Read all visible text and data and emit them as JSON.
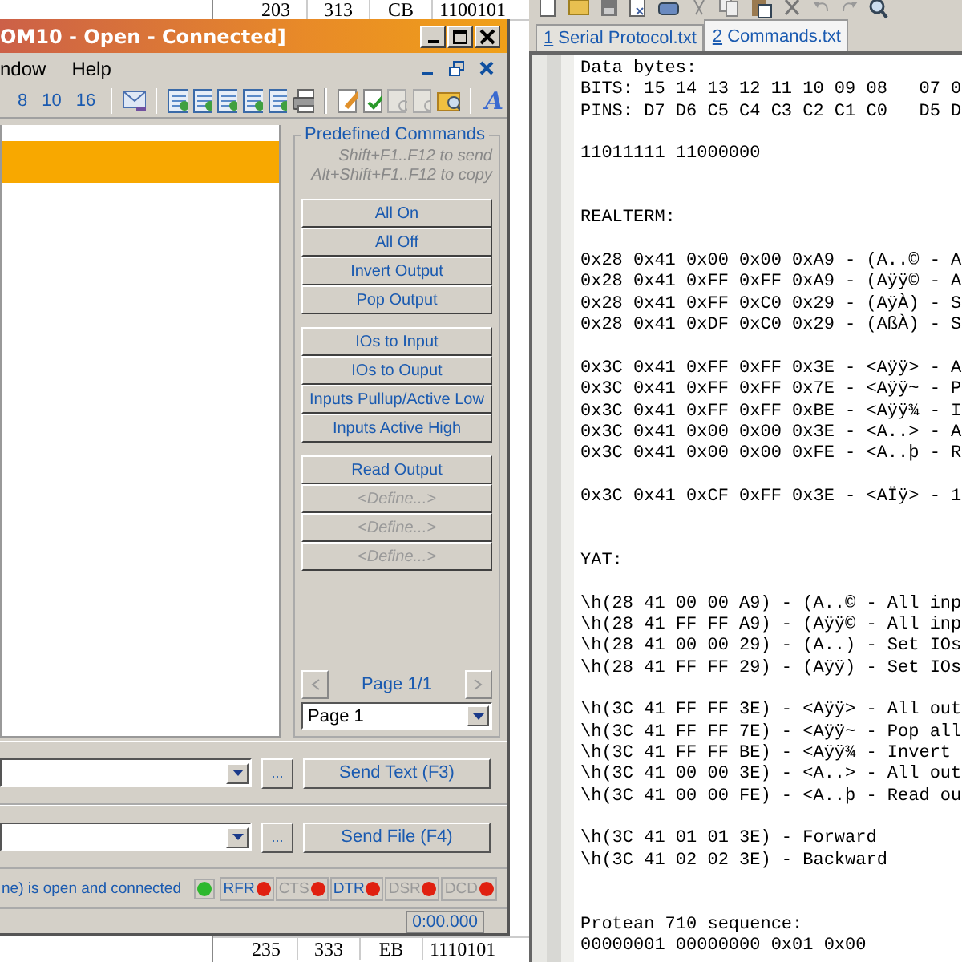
{
  "sheet": {
    "top_row": [
      "203",
      "313",
      "CB",
      "1100101"
    ],
    "bottom_row": [
      "235",
      "333",
      "EB",
      "1110101"
    ]
  },
  "terminal": {
    "title": "OM10 - Open - Connected]",
    "menu": [
      "ndow",
      "Help"
    ],
    "radix_buttons": [
      "8",
      "10",
      "16"
    ],
    "font_button": "A",
    "predefined": {
      "title": "Predefined Commands",
      "hint_send": "Shift+F1..F12 to send",
      "hint_copy": "Alt+Shift+F1..F12 to copy",
      "groups": [
        [
          {
            "label": "All On",
            "defined": true
          },
          {
            "label": "All Off",
            "defined": true
          },
          {
            "label": "Invert Output",
            "defined": true
          },
          {
            "label": "Pop Output",
            "defined": true
          }
        ],
        [
          {
            "label": "IOs to Input",
            "defined": true
          },
          {
            "label": "IOs to Ouput",
            "defined": true
          },
          {
            "label": "Inputs Pullup/Active Low",
            "defined": true
          },
          {
            "label": "Inputs Active High",
            "defined": true
          }
        ],
        [
          {
            "label": "Read Output",
            "defined": true
          },
          {
            "label": "<Define...>",
            "defined": false
          },
          {
            "label": "<Define...>",
            "defined": false
          },
          {
            "label": "<Define...>",
            "defined": false
          }
        ]
      ],
      "page_label": "Page 1/1",
      "page_select": "Page 1"
    },
    "send_text": {
      "browse": "...",
      "button": "Send Text (F3)"
    },
    "send_file": {
      "browse": "...",
      "button": "Send File (F4)"
    },
    "status": {
      "message": "ne) is open and connected",
      "connection": {
        "color": "#2db82d"
      },
      "signals": [
        {
          "label": "RFR",
          "enabled": true,
          "color": "#e02010"
        },
        {
          "label": "CTS",
          "enabled": false,
          "color": "#e02010"
        },
        {
          "label": "DTR",
          "enabled": true,
          "color": "#e02010"
        },
        {
          "label": "DSR",
          "enabled": false,
          "color": "#e02010"
        },
        {
          "label": "DCD",
          "enabled": false,
          "color": "#e02010"
        }
      ]
    },
    "timer": "0:00.000"
  },
  "editor": {
    "tabs": [
      {
        "number": "1",
        "label": "Serial Protocol.txt",
        "selected": false
      },
      {
        "number": "2",
        "label": "Commands.txt",
        "selected": true
      }
    ],
    "lines": [
      {
        "kind": "text",
        "text": "Data bytes:"
      },
      {
        "kind": "text",
        "text": "BITS: 15 14 13 12 11 10 09 08   07 0"
      },
      {
        "kind": "text",
        "text": "PINS: D7 D6 C5 C4 C3 C2 C1 C0   D5 D"
      },
      {
        "kind": "blank"
      },
      {
        "kind": "text",
        "text": "11011111 11000000"
      },
      {
        "kind": "blank"
      },
      {
        "kind": "blank"
      },
      {
        "kind": "text",
        "text": "REALTERM:"
      },
      {
        "kind": "blank"
      },
      {
        "kind": "text",
        "text": "0x28 0x41 0x00 0x00 0xA9 - (A..© - A"
      },
      {
        "kind": "text",
        "text": "0x28 0x41 0xFF 0xFF 0xA9 - (Aÿÿ© - A"
      },
      {
        "kind": "text",
        "text": "0x28 0x41 0xFF 0xC0 0x29 - (AÿÀ) - S"
      },
      {
        "kind": "text",
        "text": "0x28 0x41 0xDF 0xC0 0x29 - (AßÀ) - S"
      },
      {
        "kind": "blank"
      },
      {
        "kind": "text",
        "text": "0x3C 0x41 0xFF 0xFF 0x3E - <Aÿÿ> - A"
      },
      {
        "kind": "text",
        "text": "0x3C 0x41 0xFF 0xFF 0x7E - <Aÿÿ~ - P"
      },
      {
        "kind": "text",
        "text": "0x3C 0x41 0xFF 0xFF 0xBE - <Aÿÿ¾ - I"
      },
      {
        "kind": "text",
        "text": "0x3C 0x41 0x00 0x00 0x3E - <A..> - A"
      },
      {
        "kind": "text",
        "text": "0x3C 0x41 0x00 0x00 0xFE - <A..þ - R"
      },
      {
        "kind": "blank"
      },
      {
        "kind": "text",
        "text": "0x3C 0x41 0xCF 0xFF 0x3E - <AÏÿ> - 1"
      },
      {
        "kind": "blank"
      },
      {
        "kind": "blank"
      },
      {
        "kind": "text",
        "text": "YAT:"
      },
      {
        "kind": "blank"
      },
      {
        "kind": "text",
        "text": "\\h(28 41 00 00 A9) - (A..© - All inp"
      },
      {
        "kind": "text",
        "text": "\\h(28 41 FF FF A9) - (Aÿÿ© - All inp"
      },
      {
        "kind": "text",
        "text": "\\h(28 41 00 00 29) - (A..) - Set IOs"
      },
      {
        "kind": "text",
        "text": "\\h(28 41 FF FF 29) - (Aÿÿ) - Set IOs"
      },
      {
        "kind": "blank"
      },
      {
        "kind": "text",
        "text": "\\h(3C 41 FF FF 3E) - <Aÿÿ> - All out"
      },
      {
        "kind": "text",
        "text": "\\h(3C 41 FF FF 7E) - <Aÿÿ~ - Pop all"
      },
      {
        "kind": "text",
        "text": "\\h(3C 41 FF FF BE) - <Aÿÿ¾ - Invert"
      },
      {
        "kind": "text",
        "text": "\\h(3C 41 00 00 3E) - <A..> - All out"
      },
      {
        "kind": "text",
        "text": "\\h(3C 41 00 00 FE) - <A..þ - Read ou"
      },
      {
        "kind": "blank"
      },
      {
        "kind": "text",
        "text": "\\h(3C 41 01 01 3E) - Forward"
      },
      {
        "kind": "text",
        "text": "\\h(3C 41 02 02 3E) - Backward"
      },
      {
        "kind": "blank"
      },
      {
        "kind": "blank"
      },
      {
        "kind": "text",
        "text": "Protean 710 sequence:"
      },
      {
        "kind": "text",
        "text": "00000001 00000000 0x01 0x00"
      }
    ]
  }
}
